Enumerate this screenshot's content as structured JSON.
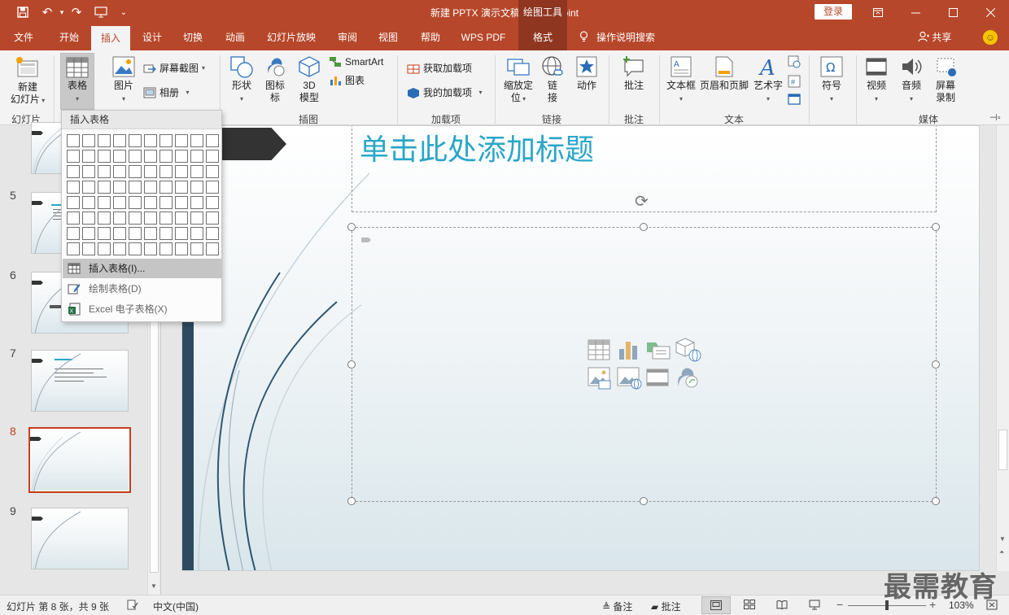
{
  "titlebar": {
    "doc_title": "新建 PPTX 演示文稿  -  PowerPoint",
    "contextual_group": "绘图工具",
    "login": "登录"
  },
  "tabs": [
    {
      "label": "文件"
    },
    {
      "label": "开始"
    },
    {
      "label": "插入"
    },
    {
      "label": "设计"
    },
    {
      "label": "切换"
    },
    {
      "label": "动画"
    },
    {
      "label": "幻灯片放映"
    },
    {
      "label": "审阅"
    },
    {
      "label": "视图"
    },
    {
      "label": "帮助"
    },
    {
      "label": "WPS PDF"
    },
    {
      "label": "格式"
    }
  ],
  "tell_me": "操作说明搜索",
  "share": "共享",
  "ribbon": {
    "new_slide": {
      "line1": "新建",
      "line2": "幻灯片"
    },
    "table": "表格",
    "picture": "图片",
    "screenshot": "屏幕截图",
    "album": "相册",
    "shapes": "形状",
    "icons": "图标",
    "model3d": {
      "line1": "3D",
      "line2": "模型"
    },
    "smartart": "SmartArt",
    "chart": "图表",
    "get_addins": "获取加载项",
    "my_addins": "我的加载项",
    "zoom": {
      "line1": "缩放定",
      "line2": "位"
    },
    "link": {
      "line1": "链",
      "line2": "接"
    },
    "action": "动作",
    "comment": "批注",
    "textbox": "文本框",
    "header_footer": "页眉和页脚",
    "wordart": "艺术字",
    "symbols": "符号",
    "video": "视频",
    "audio": "音频",
    "screen_record": {
      "line1": "屏幕",
      "line2": "录制"
    },
    "groups": {
      "slides": "幻灯片",
      "illustrations": "插图",
      "addins": "加载项",
      "links": "链接",
      "comments": "批注",
      "text": "文本",
      "media": "媒体"
    }
  },
  "table_menu": {
    "title": "插入表格",
    "insert_table": "插入表格(I)...",
    "draw_table": "绘制表格(D)",
    "excel_table": "Excel 电子表格(X)"
  },
  "slides": [
    {
      "num": "5"
    },
    {
      "num": "6"
    },
    {
      "num": "7"
    },
    {
      "num": "8"
    },
    {
      "num": "9"
    }
  ],
  "slide": {
    "title_placeholder": "单击此处添加标题"
  },
  "statusbar": {
    "slide_count": "幻灯片 第 8 张，共 9 张",
    "language": "中文(中国)",
    "notes": "备注",
    "comments": "批注",
    "zoom": "103%"
  },
  "watermark": "最需教育",
  "colors": {
    "accent": "#b7472a",
    "title_text": "#2aa6c8",
    "active_slide_border": "#c43e1c"
  }
}
